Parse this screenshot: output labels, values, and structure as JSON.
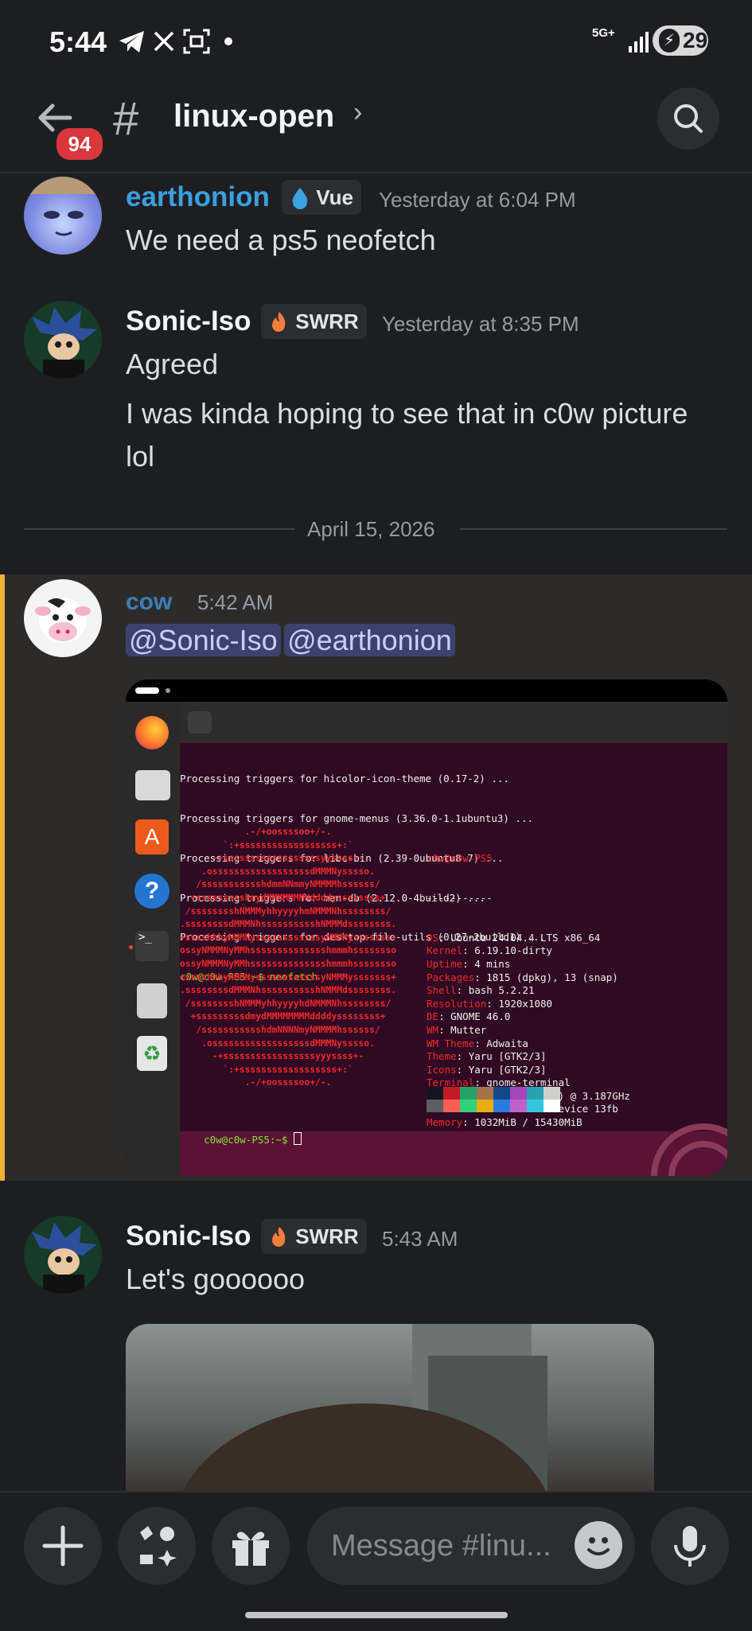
{
  "status_bar": {
    "time": "5:44",
    "network": "5G+",
    "battery": "29",
    "icons": [
      "telegram-icon",
      "x-icon",
      "scan-icon",
      "dot-icon"
    ]
  },
  "header": {
    "back_badge": "94",
    "hash": "#",
    "channel": "linux-open",
    "chevron": "›"
  },
  "messages": [
    {
      "user": "earthonion",
      "tag": "Vue",
      "tag_icon": "droplet-icon",
      "time": "Yesterday at 6:04 PM",
      "lines": [
        "We need a ps5 neofetch"
      ],
      "name_color": "#3b9fe0"
    },
    {
      "user": "Sonic-Iso",
      "tag": "SWRR",
      "tag_icon": "flame-icon",
      "time": "Yesterday at 8:35 PM",
      "lines": [
        "Agreed",
        "I was kinda hoping to see that in c0w picture",
        "lol"
      ]
    },
    {
      "user": "cow",
      "time": "5:42 AM",
      "mentions": [
        "@Sonic-Iso",
        "@earthonion"
      ],
      "name_color": "#3b7fb8"
    },
    {
      "user": "Sonic-Iso",
      "tag": "SWRR",
      "tag_icon": "flame-icon",
      "time": "5:43 AM",
      "lines": [
        "Let's goooooo"
      ]
    }
  ],
  "date_divider": "April 15, 2026",
  "terminal": {
    "log": [
      "Processing triggers for hicolor-icon-theme (0.17-2) ...",
      "Processing triggers for gnome-menus (3.36.0-1.1ubuntu3) ...",
      "Processing triggers for libc-bin (2.39-0ubuntu8.7) ...",
      "Processing triggers for man-db (2.12.0-4build2) ...",
      "Processing triggers for desktop-file-utils (0.27-2build1) ..."
    ],
    "prompt": "c0w@c0w-PS5:~$ neofetch",
    "final_prompt": "c0w@c0w-PS5:~$ ",
    "user_host": "c0w@c0w-PS5",
    "separator": "-----------",
    "info": [
      [
        "OS",
        "Ubuntu 24.04.4 LTS x86_64"
      ],
      [
        "Kernel",
        "6.19.10-dirty"
      ],
      [
        "Uptime",
        "4 mins"
      ],
      [
        "Packages",
        "1815 (dpkg), 13 (snap)"
      ],
      [
        "Shell",
        "bash 5.2.21"
      ],
      [
        "Resolution",
        "1920x1080"
      ],
      [
        "DE",
        "GNOME 46.0"
      ],
      [
        "WM",
        "Mutter"
      ],
      [
        "WM Theme",
        "Adwaita"
      ],
      [
        "Theme",
        "Yaru [GTK2/3]"
      ],
      [
        "Icons",
        "Yaru [GTK2/3]"
      ],
      [
        "Terminal",
        "gnome-terminal"
      ],
      [
        "CPU",
        "100-000000575 (16) @ 3.187GHz"
      ],
      [
        "GPU",
        "AMD ATI 20:00.0 Device 13fb"
      ],
      [
        "Memory",
        "1032MiB / 15430MiB"
      ]
    ],
    "ascii": [
      "            .-/+oossssoo+/-.",
      "        `:+ssssssssssssssssss+:`",
      "      -+ssssssssssssssssssyyssss+-",
      "    .ossssssssssssssssssdMMMNysssso.",
      "   /ssssssssssshdmmNNmmyNMMMMhssssss/",
      "  +ssssssssshmydMMMMMMMNddddyssssssss+",
      " /sssssssshNMMMyhhyyyyhmNMMMNhssssssss/",
      ".ssssssssdMMMNhsssssssssshNMMMdssssssss.",
      "+sssshhhyNMMNyssssssssssssyNMMMysssssss+",
      "ossyNMMMNyMMhsssssssssssssshmmmhssssssso",
      "ossyNMMMNyMMhsssssssssssssshmmmhssssssso",
      "+sssshhhyNMMNyssssssssssssyNMMMysssssss+",
      ".ssssssssdMMMNhsssssssssshNMMMdssssssss.",
      " /sssssssshNMMMyhhyyyyhdNMMMNhssssssss/",
      "  +sssssssssdmydMMMMMMMMddddyssssssss+",
      "   /ssssssssssshdmNNNNmyNMMMMhssssss/",
      "    .ossssssssssssssssssdMMMNysssso.",
      "      -+sssssssssssssssssyyyssss+-",
      "        `:+ssssssssssssssssss+:`",
      "            .-/+oossssoo+/-."
    ],
    "palette_top": [
      "#171421",
      "#c01c28",
      "#26a269",
      "#a2734c",
      "#12488b",
      "#a347ba",
      "#2aa1b3",
      "#d0cfcc"
    ],
    "palette_bottom": [
      "#5e5c64",
      "#f66151",
      "#33d17a",
      "#e9ad0c",
      "#2a7bde",
      "#c061cb",
      "#33c7de",
      "#ffffff"
    ]
  },
  "composer": {
    "placeholder": "Message #linu..."
  }
}
